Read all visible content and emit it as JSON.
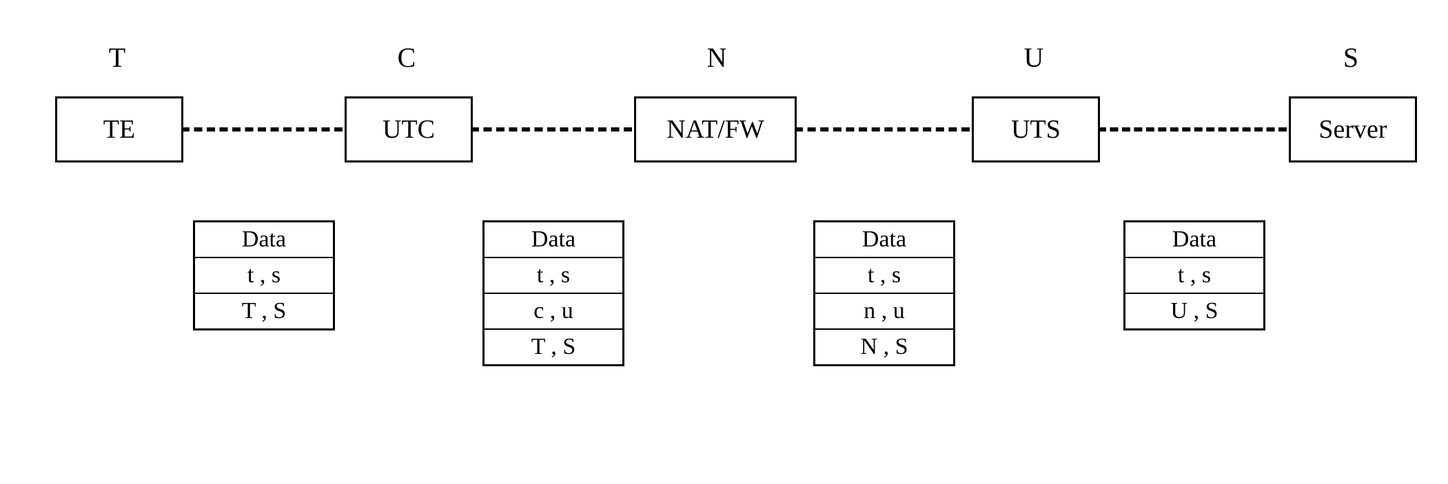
{
  "labels": {
    "T": "T",
    "C": "C",
    "N": "N",
    "U": "U",
    "S": "S"
  },
  "nodes": {
    "TE": "TE",
    "UTC": "UTC",
    "NAT": "NAT/FW",
    "UTS": "UTS",
    "Server": "Server"
  },
  "packets": {
    "p1": {
      "r0": "Data",
      "r1": "t , s",
      "r2": "T , S"
    },
    "p2": {
      "r0": "Data",
      "r1": "t , s",
      "r2": "c , u",
      "r3": "T , S"
    },
    "p3": {
      "r0": "Data",
      "r1": "t , s",
      "r2": "n , u",
      "r3": "N , S"
    },
    "p4": {
      "r0": "Data",
      "r1": "t , s",
      "r2": "U , S"
    }
  }
}
